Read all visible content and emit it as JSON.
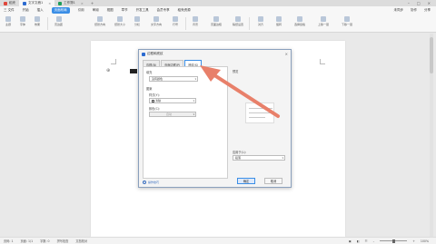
{
  "tabs": [
    {
      "label": "稻壳",
      "color": "#e0463b"
    },
    {
      "label": "文字文稿1",
      "color": "#2c6bd0",
      "active": true
    },
    {
      "label": "工作簿1",
      "color": "#1e9e5b"
    }
  ],
  "menu": {
    "items": [
      "三 文件",
      "开始",
      "插入",
      "页面布局",
      "引用",
      "审阅",
      "视图",
      "章节",
      "开发工具",
      "会员专享",
      "稻壳资源"
    ],
    "active_index": 3,
    "right_items": [
      "未同步",
      "协作",
      "分享"
    ]
  },
  "ribbon": {
    "groups": [
      "主题",
      "字体",
      "效果",
      "页边距",
      "纸张方向",
      "纸张大小",
      "分栏",
      "文字方向",
      "行号",
      "背景",
      "页面边框",
      "稿纸设置",
      "对齐",
      "旋转",
      "选择窗格",
      "上移一层",
      "下移一层"
    ]
  },
  "dialog": {
    "title": "边框和底纹",
    "tabs": [
      "边框(B)",
      "页面边框(P)",
      "底纹(S)"
    ],
    "active_tab_index": 2,
    "fill_label": "填充",
    "fill_value": "没有颜色",
    "pattern_label": "图案",
    "style_label": "样式(Y):",
    "style_value": "清除",
    "color_label": "颜色(C):",
    "color_value": "自动",
    "preview_label": "预览",
    "apply_label": "应用于(L):",
    "apply_value": "段落",
    "help_text": "操作技巧",
    "ok_label": "确定",
    "cancel_label": "取消"
  },
  "status": {
    "page": "页码: 1",
    "pages": "页面: 1/1",
    "words": "字数: 0",
    "spell": "拼写检查",
    "proof": "文档校对",
    "zoom": "100%"
  },
  "colors": {
    "accent": "#3a8ee6",
    "arrow": "#e8806a"
  }
}
